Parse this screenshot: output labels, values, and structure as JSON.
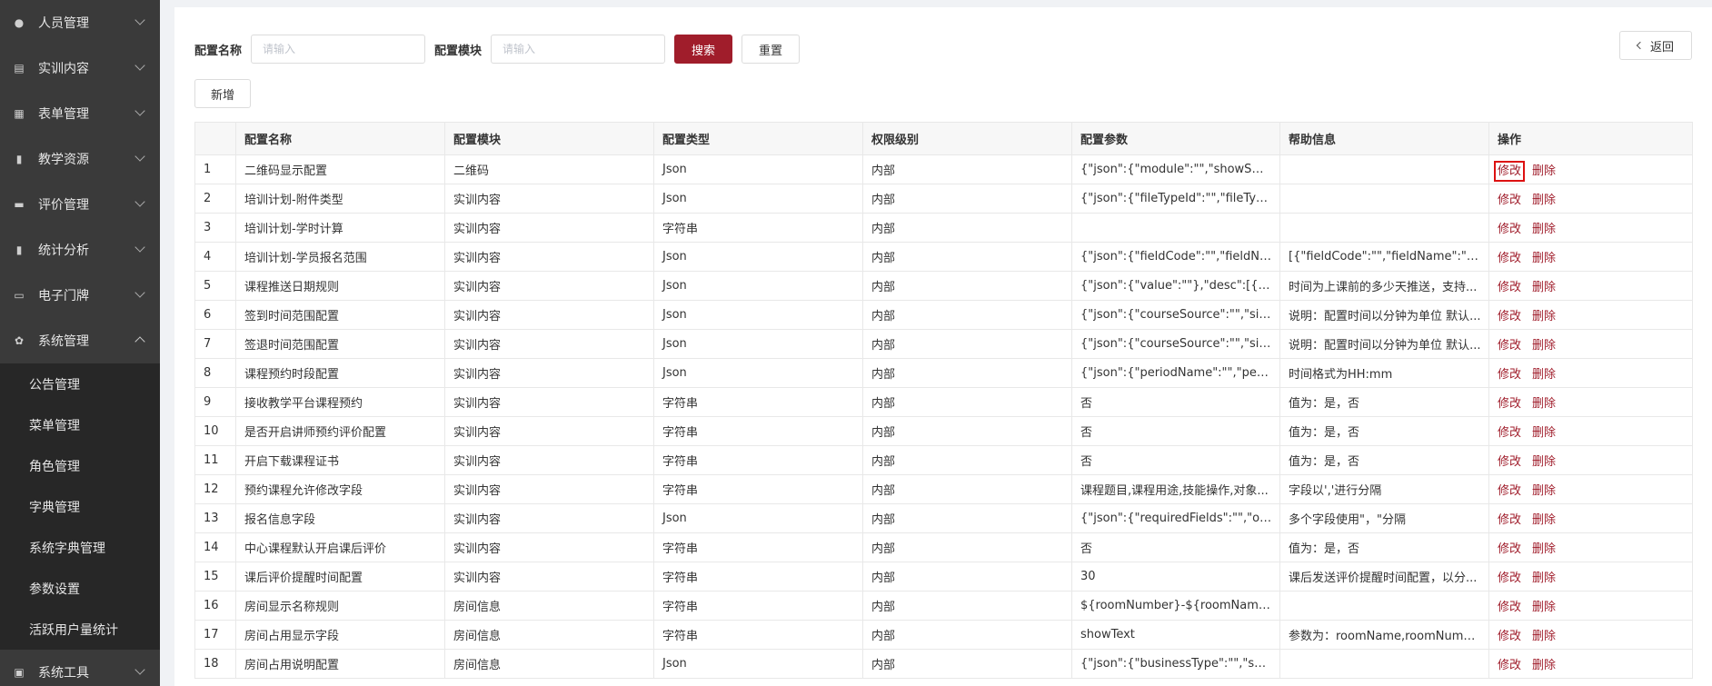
{
  "sidebar": {
    "items": [
      {
        "label": "人员管理",
        "icon": "user-icon"
      },
      {
        "label": "实训内容",
        "icon": "document-icon"
      },
      {
        "label": "表单管理",
        "icon": "form-icon"
      },
      {
        "label": "教学资源",
        "icon": "book-icon"
      },
      {
        "label": "评价管理",
        "icon": "rating-icon"
      },
      {
        "label": "统计分析",
        "icon": "bar-chart-icon"
      },
      {
        "label": "电子门牌",
        "icon": "monitor-icon"
      },
      {
        "label": "系统管理",
        "icon": "gear-icon"
      }
    ],
    "subitems": [
      "公告管理",
      "菜单管理",
      "角色管理",
      "字典管理",
      "系统字典管理",
      "参数设置",
      "活跃用户量统计"
    ],
    "tools": {
      "label": "系统工具",
      "icon": "toolbox-icon"
    }
  },
  "search": {
    "name_label": "配置名称",
    "name_placeholder": "请输入",
    "module_label": "配置模块",
    "module_placeholder": "请输入",
    "search_label": "搜索",
    "reset_label": "重置",
    "back_label": "返回",
    "add_label": "新增"
  },
  "table": {
    "headers": [
      "",
      "配置名称",
      "配置模块",
      "配置类型",
      "权限级别",
      "配置参数",
      "帮助信息",
      "操作"
    ],
    "edit_label": "修改",
    "delete_label": "删除",
    "rows": [
      [
        "1",
        "二维码显示配置",
        "二维码",
        "Json",
        "内部",
        "{\"json\":{\"module\":\"\",\"showSwitch\":\"...",
        ""
      ],
      [
        "2",
        "培训计划-附件类型",
        "实训内容",
        "Json",
        "内部",
        "{\"json\":{\"fileTypeId\":\"\",\"fileTypeNam...",
        ""
      ],
      [
        "3",
        "培训计划-学时计算",
        "实训内容",
        "字符串",
        "内部",
        "",
        ""
      ],
      [
        "4",
        "培训计划-学员报名范围",
        "实训内容",
        "Json",
        "内部",
        "{\"json\":{\"fieldCode\":\"\",\"fieldName\":\"...",
        "[{\"fieldCode\":\"\",\"fieldName\":\"\",\"arch..."
      ],
      [
        "5",
        "课程推送日期规则",
        "实训内容",
        "Json",
        "内部",
        "{\"json\":{\"value\":\"\"},\"desc\":[{\"keyId\":\"...",
        "时间为上课前的多少天推送，支持..."
      ],
      [
        "6",
        "签到时间范围配置",
        "实训内容",
        "Json",
        "内部",
        "{\"json\":{\"courseSource\":\"\",\"signInSt...",
        "说明：配置时间以分钟为单位 默认..."
      ],
      [
        "7",
        "签退时间范围配置",
        "实训内容",
        "Json",
        "内部",
        "{\"json\":{\"courseSource\":\"\",\"signOut...",
        "说明：配置时间以分钟为单位 默认..."
      ],
      [
        "8",
        "课程预约时段配置",
        "实训内容",
        "Json",
        "内部",
        "{\"json\":{\"periodName\":\"\",\"periodSta...",
        "时间格式为HH:mm"
      ],
      [
        "9",
        "接收教学平台课程预约",
        "实训内容",
        "字符串",
        "内部",
        "否",
        "值为：是，否"
      ],
      [
        "10",
        "是否开启讲师预约评价配置",
        "实训内容",
        "字符串",
        "内部",
        "否",
        "值为：是，否"
      ],
      [
        "11",
        "开启下载课程证书",
        "实训内容",
        "字符串",
        "内部",
        "否",
        "值为：是，否"
      ],
      [
        "12",
        "预约课程允许修改字段",
        "实训内容",
        "字符串",
        "内部",
        "课程题目,课程用途,技能操作,对象...",
        "字段以','进行分隔"
      ],
      [
        "13",
        "报名信息字段",
        "实训内容",
        "Json",
        "内部",
        "{\"json\":{\"requiredFields\":\"\",\"optional...",
        "多个字段使用\"，\"分隔"
      ],
      [
        "14",
        "中心课程默认开启课后评价",
        "实训内容",
        "字符串",
        "内部",
        "否",
        "值为：是，否"
      ],
      [
        "15",
        "课后评价提醒时间配置",
        "实训内容",
        "字符串",
        "内部",
        "30",
        "课后发送评价提醒时间配置，以分..."
      ],
      [
        "16",
        "房间显示名称规则",
        "房间信息",
        "字符串",
        "内部",
        "${roomNumber}-${roomName}",
        ""
      ],
      [
        "17",
        "房间占用显示字段",
        "房间信息",
        "字符串",
        "内部",
        "showText",
        "参数为：roomName,roomNumber,..."
      ],
      [
        "18",
        "房间占用说明配置",
        "房间信息",
        "Json",
        "内部",
        "{\"json\":{\"businessType\":\"\",\"showRu...",
        ""
      ]
    ]
  }
}
